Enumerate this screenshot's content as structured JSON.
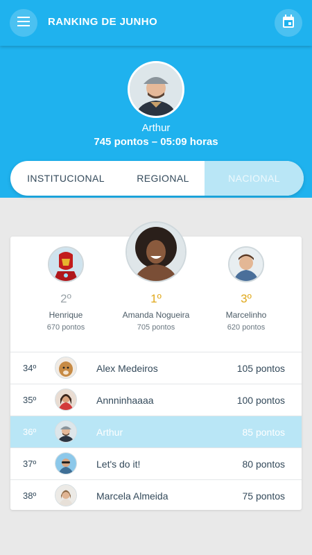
{
  "colors": {
    "primary": "#1fb2ee",
    "highlight": "#b9e6f6",
    "gold": "#e0a81b",
    "silver": "#9aa3a8"
  },
  "appbar": {
    "title": "RANKING DE JUNHO",
    "menu_icon": "menu-icon",
    "calendar_icon": "calendar-icon"
  },
  "me": {
    "name": "Arthur",
    "score": "745 pontos – 05:09 horas"
  },
  "tabs": [
    {
      "label": "INSTITUCIONAL"
    },
    {
      "label": "REGIONAL"
    },
    {
      "label": "NACIONAL",
      "selected": true
    }
  ],
  "podium": {
    "second": {
      "rank": "2º",
      "name": "Henrique",
      "points": "670 pontos"
    },
    "first": {
      "rank": "1º",
      "name": "Amanda Nogueira",
      "points": "705 pontos"
    },
    "third": {
      "rank": "3º",
      "name": "Marcelinho",
      "points": "620 pontos"
    }
  },
  "ranking": [
    {
      "pos": "34º",
      "name": "Alex Medeiros",
      "points": "105 pontos"
    },
    {
      "pos": "35º",
      "name": "Annninhaaaa",
      "points": "100 pontos"
    },
    {
      "pos": "36º",
      "name": "Arthur",
      "points": "85 pontos",
      "current_user": true
    },
    {
      "pos": "37º",
      "name": "Let's do it!",
      "points": "80 pontos"
    },
    {
      "pos": "38º",
      "name": "Marcela Almeida",
      "points": "75 pontos"
    }
  ]
}
